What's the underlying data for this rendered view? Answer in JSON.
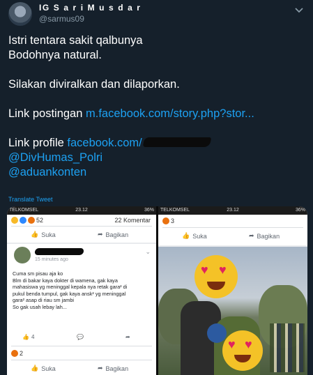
{
  "tweet": {
    "author_name": "IG S a r i M u s d a r",
    "author_handle": "@sarmus09",
    "lines": [
      "Istri tentara sakit qalbunya",
      "Bodohnya natural.",
      "",
      "Silakan diviralkan dan dilaporkan.",
      ""
    ],
    "post_link_label": "Link postingan ",
    "post_link_url": "m.facebook.com/story.php?stor...",
    "profile_link_label": "Link profile ",
    "profile_link_url": "facebook.com/",
    "mentions": [
      "@DivHumas_Polri",
      "@aduankonten"
    ],
    "translate": "Translate Tweet"
  },
  "screenshots": {
    "left": {
      "status": {
        "carrier": "TELKOMSEL",
        "time": "23.12",
        "battery": "36%"
      },
      "reactions_count": "52",
      "comments_count": "22 Komentar",
      "like_label": "Suka",
      "share_label": "Bagikan",
      "comment_time": "15 minutes ago",
      "comment_lines": [
        "Cuma sm pisau aja ko",
        "Blm di bakar kaya dokter di wamena, gak kaya",
        "mahasiswa yg meninggal kepala nya retak gara² di",
        "pukul benda tumpul, gak kaya ansk² yg meninggal",
        "gara² asap di riau sm jambi",
        "So gak usah lebay lah..."
      ],
      "comment_likes": "4",
      "reply_reactions": "2"
    },
    "right": {
      "status": {
        "carrier": "TELKOMSEL",
        "time": "23.12",
        "battery": "36%"
      },
      "reactions_count": "3",
      "like_label": "Suka",
      "share_label": "Bagikan"
    }
  },
  "colors": {
    "background": "#15202b",
    "link": "#1da1f2",
    "secondary_text": "#8899a6"
  }
}
